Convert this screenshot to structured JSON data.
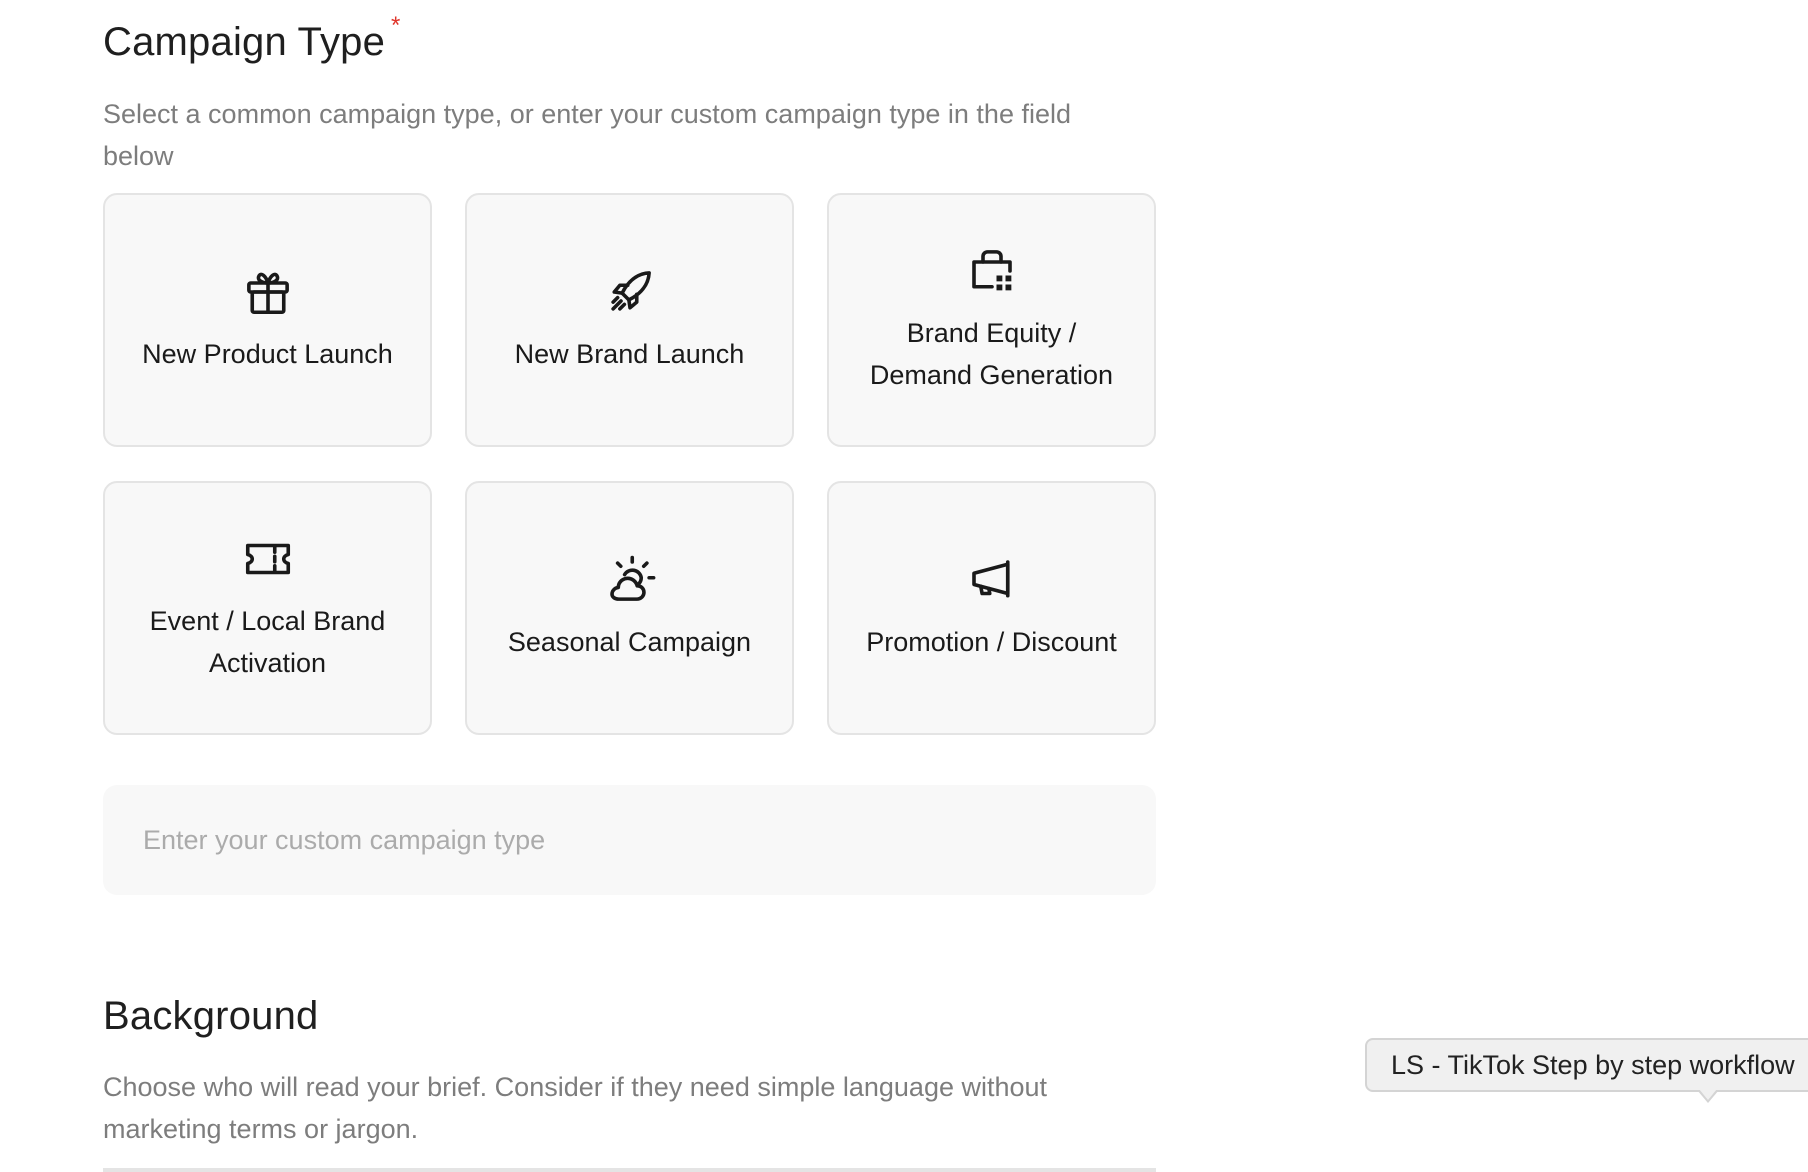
{
  "campaign_type": {
    "title": "Campaign Type",
    "required_marker": "*",
    "description": "Select a common campaign type, or enter your custom campaign type in the field below",
    "options": [
      {
        "label": "New Product Launch",
        "icon": "gift-icon"
      },
      {
        "label": "New Brand Launch",
        "icon": "rocket-icon"
      },
      {
        "label": "Brand Equity / Demand Generation",
        "icon": "shop-grid-icon"
      },
      {
        "label": "Event / Local Brand Activation",
        "icon": "ticket-icon"
      },
      {
        "label": "Seasonal Campaign",
        "icon": "sun-cloud-icon"
      },
      {
        "label": "Promotion / Discount",
        "icon": "megaphone-icon"
      }
    ],
    "custom_input": {
      "value": "",
      "placeholder": "Enter your custom campaign type"
    }
  },
  "background": {
    "title": "Background",
    "description": "Choose who will read your brief. Consider if they need simple language without marketing terms or jargon."
  },
  "tooltip": {
    "text": "LS - TikTok Step by step workflow"
  }
}
